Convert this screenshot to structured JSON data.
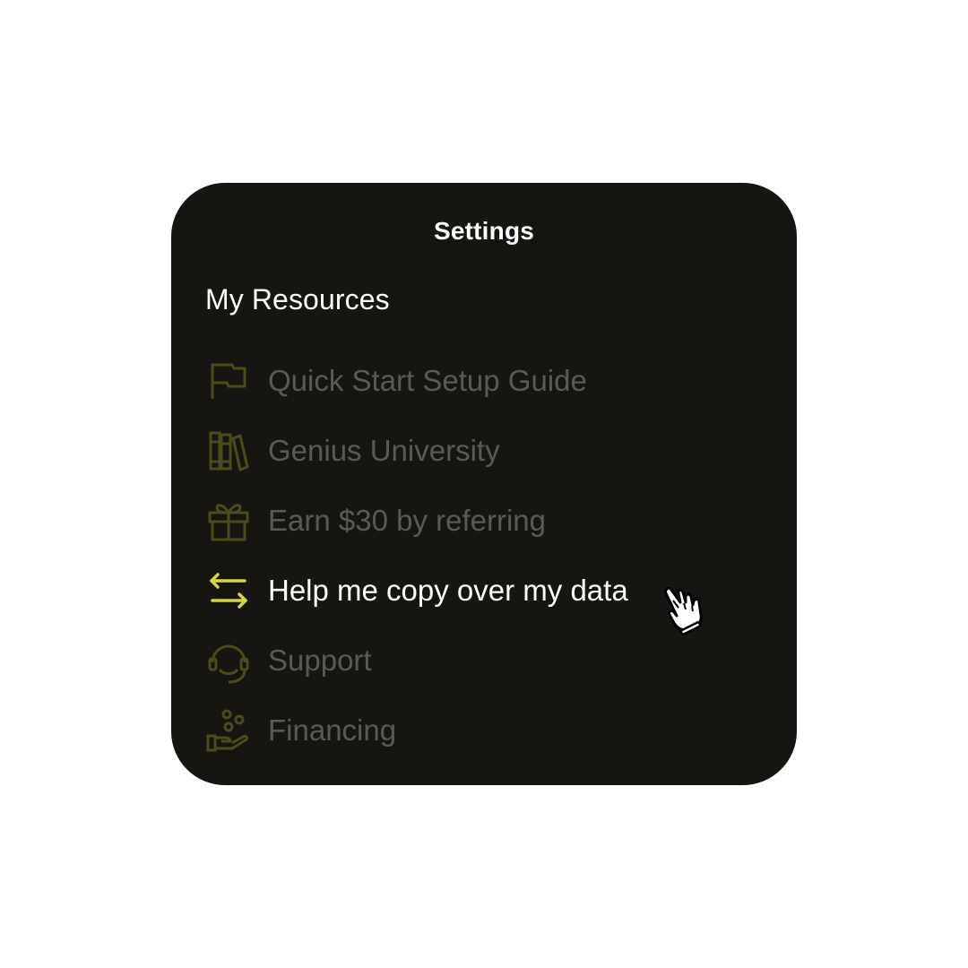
{
  "panel": {
    "title": "Settings",
    "section_title": "My Resources"
  },
  "menu": {
    "items": [
      {
        "label": "Quick Start Setup Guide",
        "icon": "flag-icon",
        "state": "dim"
      },
      {
        "label": "Genius University",
        "icon": "books-icon",
        "state": "dim"
      },
      {
        "label": "Earn $30 by referring",
        "icon": "gift-icon",
        "state": "dim"
      },
      {
        "label": "Help me copy over my data",
        "icon": "transfer-arrows-icon",
        "state": "active"
      },
      {
        "label": "Support",
        "icon": "headset-icon",
        "state": "dim"
      },
      {
        "label": "Financing",
        "icon": "hand-coins-icon",
        "state": "dim"
      }
    ]
  },
  "colors": {
    "panel_background": "#161511",
    "dim_text": "#5a5a55",
    "dim_icon": "#4a4d18",
    "active_text": "#ffffff",
    "active_icon": "#d4d63a"
  }
}
